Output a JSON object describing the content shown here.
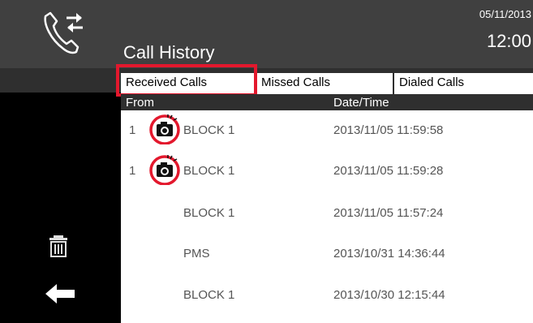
{
  "header": {
    "title": "Call History",
    "date": "05/11/2013",
    "time": "12:00"
  },
  "tabs": [
    {
      "label": "Received Calls",
      "selected": true
    },
    {
      "label": "Missed Calls",
      "selected": false
    },
    {
      "label": "Dialed Calls",
      "selected": false
    }
  ],
  "columns": {
    "from": "From",
    "datetime": "Date/Time"
  },
  "rows": [
    {
      "number": "1",
      "has_image": true,
      "from": "BLOCK 1",
      "datetime": "2013/11/05 11:59:58"
    },
    {
      "number": "1",
      "has_image": true,
      "from": "BLOCK 1",
      "datetime": "2013/11/05 11:59:28"
    },
    {
      "number": "",
      "has_image": false,
      "from": "BLOCK 1",
      "datetime": "2013/11/05 11:57:24"
    },
    {
      "number": "",
      "has_image": false,
      "from": "PMS",
      "datetime": "2013/10/31 14:36:44"
    },
    {
      "number": "",
      "has_image": false,
      "from": "BLOCK 1",
      "datetime": "2013/10/30 12:15:44"
    }
  ],
  "icons": {
    "header": "phone-transfer-icon",
    "row_image": "camera-icon",
    "delete": "trash-icon",
    "back": "back-arrow-icon"
  },
  "colors": {
    "highlight": "#e3182d",
    "header_bg": "#404040",
    "sidebar_bg": "#000000"
  }
}
